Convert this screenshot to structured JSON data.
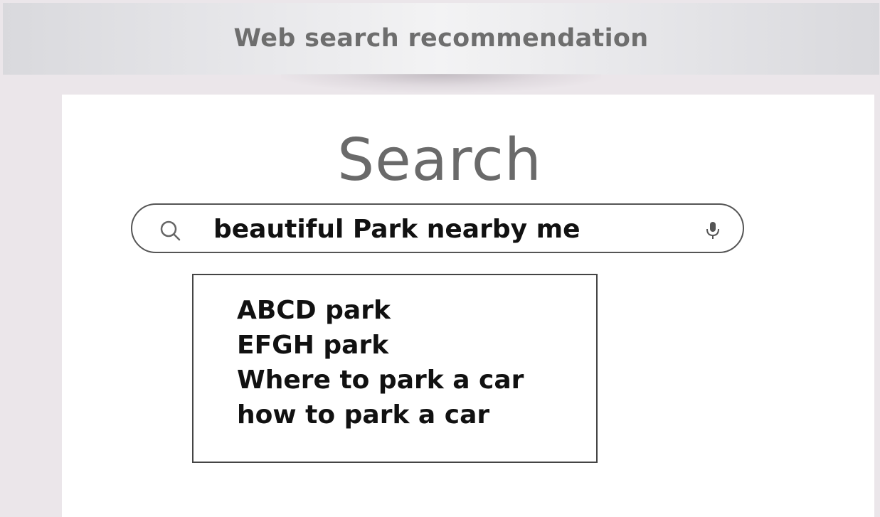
{
  "banner": {
    "title": "Web search recommendation"
  },
  "search": {
    "heading": "Search",
    "query": "beautiful Park nearby me",
    "search_icon": "search-icon",
    "mic_icon": "microphone-icon"
  },
  "suggestions": [
    "ABCD park",
    "EFGH park",
    "Where to park a car",
    "how to park a car"
  ],
  "colors": {
    "page_background": "#ebe6ea",
    "banner_text": "#6e6e6e",
    "heading_text": "#6a6a6a",
    "text": "#111111"
  }
}
